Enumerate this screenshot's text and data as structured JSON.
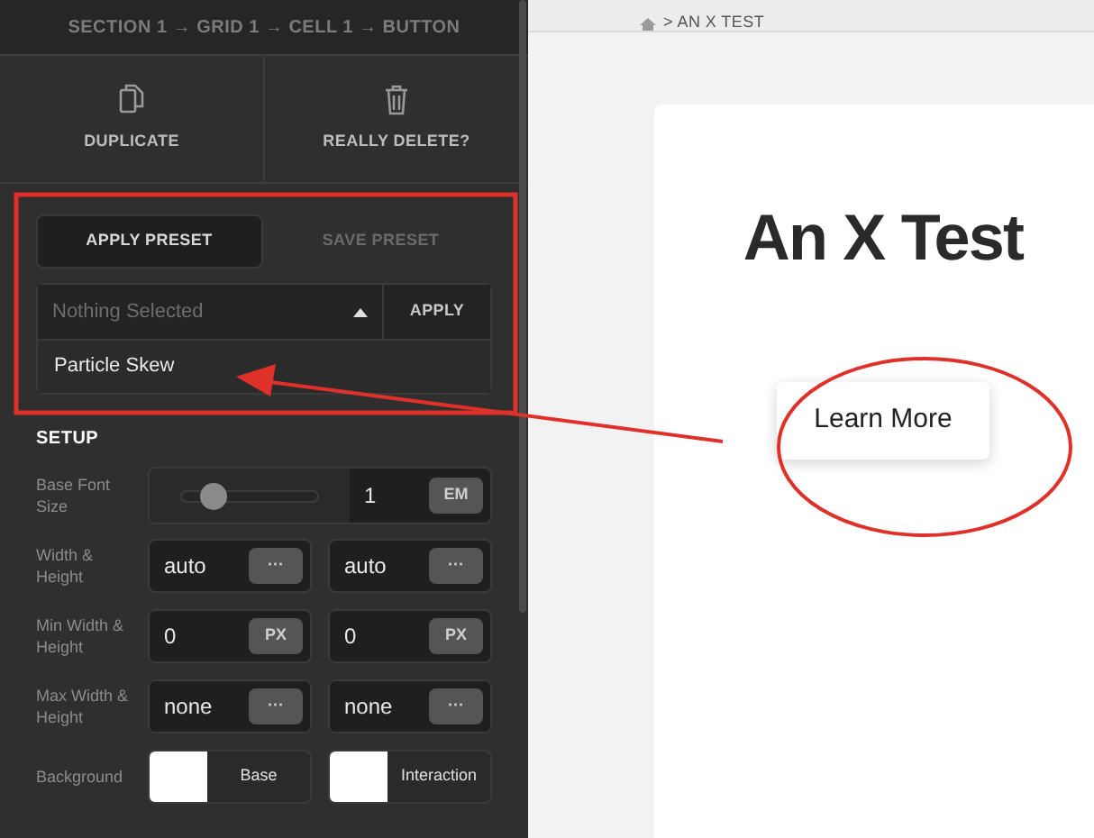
{
  "breadcrumb": {
    "text": "SECTION 1 → GRID 1 → CELL 1 → **BUTTON**"
  },
  "actions": [
    {
      "kind": "duplicate",
      "label": "DUPLICATE"
    },
    {
      "kind": "delete",
      "label": "REALLY DELETE?"
    }
  ],
  "preset_tabs": [
    {
      "label": "APPLY PRESET",
      "selected": true
    },
    {
      "label": "SAVE PRESET",
      "selected": false
    }
  ],
  "preset_select": {
    "placeholder": "Nothing Selected",
    "expanded": true,
    "button": "APPLY",
    "options": [
      "Particle Skew"
    ]
  },
  "setup": {
    "title": "SETUP",
    "rows": [
      {
        "kind": "slider",
        "label": "Base Font Size",
        "level": 0.22,
        "value": "1",
        "unit": "EM"
      },
      {
        "kind": "pair",
        "label": "Width & Height",
        "fields": [
          {
            "value": "auto",
            "unit": "···"
          },
          {
            "value": "auto",
            "unit": "···"
          }
        ]
      },
      {
        "kind": "pair",
        "label": "Min Width & Height",
        "fields": [
          {
            "value": "0",
            "unit": "PX"
          },
          {
            "value": "0",
            "unit": "PX"
          }
        ]
      },
      {
        "kind": "pair",
        "label": "Max Width & Height",
        "fields": [
          {
            "value": "none",
            "unit": "···"
          },
          {
            "value": "none",
            "unit": "···"
          }
        ]
      },
      {
        "kind": "colors",
        "label": "Background",
        "swatches": [
          {
            "label": "Base",
            "color": "#ffffff"
          },
          {
            "label": "Interaction",
            "color": "#ffffff"
          }
        ]
      }
    ]
  },
  "preview": {
    "breadcrumb": "> AN X TEST",
    "heading": "An X Test",
    "button": "Learn More"
  }
}
